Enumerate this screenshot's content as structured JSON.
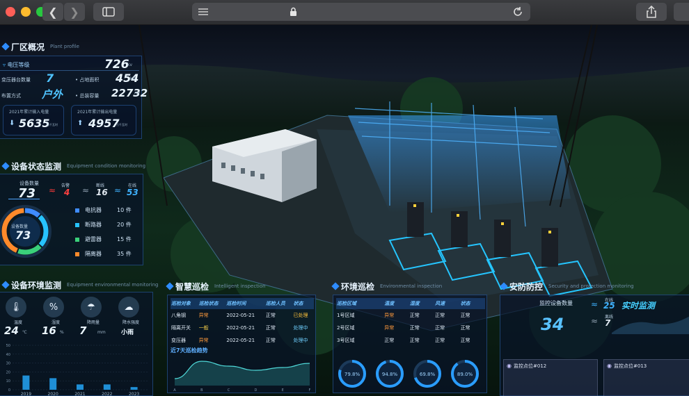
{
  "plant": {
    "title": "厂区概况",
    "title_en": "Plant profile",
    "voltage_label": "电压等级",
    "voltage_value": "726",
    "voltage_unit": "kv",
    "transformers_label": "变压器台数量",
    "transformers_value": "7",
    "area_label": "占地面积",
    "area_value": "454",
    "area_unit": "kV",
    "layout_label": "布置方式",
    "layout_value": "户外",
    "capacity_label": "总装容量",
    "capacity_value": "22732",
    "capacity_unit": "m²",
    "input_label": "2021年累计输入电量",
    "input_value": "5635",
    "input_unit": "万千瓦时",
    "output_label": "2021年累计输出电量",
    "output_value": "4957",
    "output_unit": "万千瓦时"
  },
  "equipment_status": {
    "title": "设备状态监测",
    "title_en": "Equipment condition monitoring",
    "count_label": "设备数量",
    "count_value": "73",
    "alarm_label": "告警",
    "alarm_value": "4",
    "offline_label": "断线",
    "offline_value": "16",
    "online_label": "在线",
    "online_value": "53",
    "ring_label": "设备数量",
    "ring_value": "73",
    "legend": [
      {
        "name": "电抗器",
        "value": "10 件",
        "color": "#3f8cff"
      },
      {
        "name": "断路器",
        "value": "20 件",
        "color": "#27c3ff"
      },
      {
        "name": "避雷器",
        "value": "15 件",
        "color": "#3ad07a"
      },
      {
        "name": "隔离器",
        "value": "35 件",
        "color": "#ff8a2b"
      }
    ]
  },
  "environment": {
    "title": "设备环境监测",
    "title_en": "Equipment environmental monitoring",
    "items": [
      {
        "label": "温度",
        "value": "24",
        "unit": "℃"
      },
      {
        "label": "湿度",
        "value": "16",
        "unit": "%"
      },
      {
        "label": "降雨量",
        "value": "7",
        "unit": "mm"
      },
      {
        "label": "降水强度",
        "value": "小雨",
        "unit": ""
      }
    ],
    "chart_data": {
      "type": "bar",
      "categories": [
        "2019",
        "2020",
        "2021",
        "2022",
        "2023"
      ],
      "values": [
        16,
        13,
        6,
        6,
        3
      ],
      "ylim": [
        0,
        50
      ],
      "ylabel": "",
      "title": ""
    }
  },
  "inspection": {
    "title": "智慧巡检",
    "title_en": "Intelligent inspection",
    "headers": [
      "巡检对象",
      "巡检状态",
      "巡检时间",
      "巡检人员",
      "状态"
    ],
    "rows": [
      [
        "八角钢",
        "异常",
        "2022-05-21",
        "正常",
        "已处理"
      ],
      [
        "隔离开关",
        "一般",
        "2022-05-21",
        "正常",
        "处理中"
      ],
      [
        "变压器",
        "异常",
        "2022-05-21",
        "正常",
        "处理中"
      ]
    ],
    "chart_title": "近7天巡检趋势",
    "chart_data": {
      "type": "area",
      "x": [
        "A",
        "B",
        "C",
        "D",
        "E",
        "F"
      ],
      "values": [
        10,
        35,
        28,
        22,
        26,
        32
      ],
      "title": "",
      "xlabel": "",
      "ylabel": ""
    }
  },
  "env_inspection": {
    "title": "环境巡检",
    "title_en": "Environmental inspection",
    "headers": [
      "巡检区域",
      "温度",
      "湿度",
      "风速",
      "状态"
    ],
    "rows": [
      [
        "1号区域",
        "异常",
        "正常",
        "正常",
        "正常"
      ],
      [
        "2号区域",
        "异常",
        "正常",
        "正常",
        "正常"
      ],
      [
        "3号区域",
        "正常",
        "正常",
        "正常",
        "正常"
      ]
    ],
    "gauges": [
      {
        "value": 79.8,
        "label": "79.8%"
      },
      {
        "value": 94.8,
        "label": "94.8%"
      },
      {
        "value": 69.8,
        "label": "69.8%"
      },
      {
        "value": 89.8,
        "label": "89.0%"
      }
    ]
  },
  "security": {
    "title": "安防防控",
    "title_en": "Security and protection monitoring",
    "count_label": "监控设备数量",
    "count_value": "34",
    "online_label": "在线",
    "online_value": "25",
    "offline_label": "离线",
    "offline_value": "7",
    "status_text": "实时监测",
    "cameras": [
      "监控点位#012",
      "监控点位#013"
    ]
  }
}
